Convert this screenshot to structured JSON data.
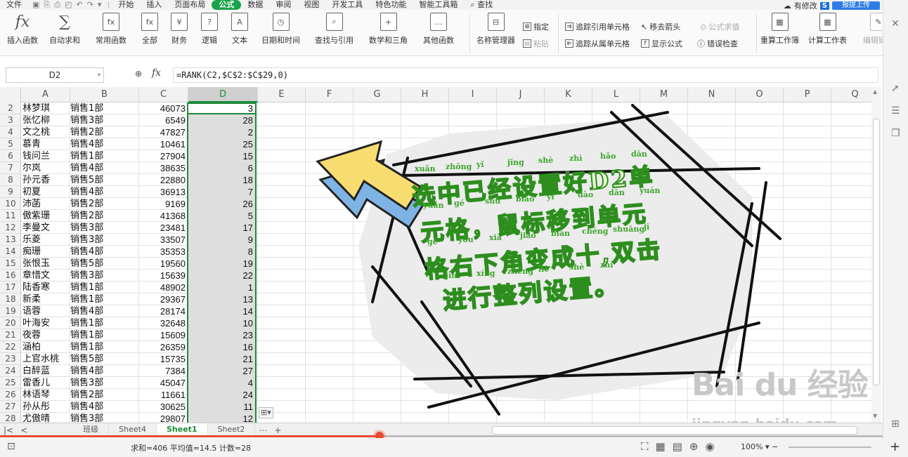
{
  "menu": {
    "file": "文件",
    "items": [
      "开始",
      "插入",
      "页面布局",
      "公式",
      "数据",
      "审阅",
      "视图",
      "开发工具",
      "特色功能",
      "智能工具箱"
    ],
    "active": "公式",
    "search": "查找",
    "modified": "有修改",
    "upload": "报提上传",
    "account_badge": "S"
  },
  "ribbon": {
    "insert_fn": "插入函数",
    "autosum": "自动求和",
    "common": "常用函数",
    "all": "全部",
    "finance": "财务",
    "logic": "逻辑",
    "text": "文本",
    "datetime": "日期和时间",
    "lookup": "查找与引用",
    "math": "数学和三角",
    "other": "其他函数",
    "name_mgr": "名称管理器",
    "define": "指定",
    "paste": "粘贴",
    "trace_prec": "追踪引用单元格",
    "trace_dep": "追踪从属单元格",
    "remove_arrows": "移去箭头",
    "show_formula": "显示公式",
    "eval": "公式求值",
    "error_check": "错误检查",
    "recalc_book": "重算工作簿",
    "calc_sheet": "计算工作表",
    "edit_links": "编辑链接"
  },
  "formula_bar": {
    "name_box": "D2",
    "fx": "fx",
    "formula": "=RANK(C2,$C$2:$C$29,0)"
  },
  "columns": [
    "A",
    "B",
    "C",
    "D",
    "E",
    "F",
    "G",
    "H",
    "I",
    "J",
    "K",
    "L",
    "M",
    "N",
    "O",
    "P",
    "Q"
  ],
  "selected_column": "D",
  "rows": [
    {
      "n": "2",
      "a": "林梦琪",
      "b": "销售1部",
      "c": "46073",
      "d": "3"
    },
    {
      "n": "3",
      "a": "张忆柳",
      "b": "销售3部",
      "c": "6549",
      "d": "28"
    },
    {
      "n": "4",
      "a": "文之桃",
      "b": "销售2部",
      "c": "47827",
      "d": "2"
    },
    {
      "n": "5",
      "a": "慕青",
      "b": "销售4部",
      "c": "10461",
      "d": "25"
    },
    {
      "n": "6",
      "a": "钱问兰",
      "b": "销售1部",
      "c": "27904",
      "d": "15"
    },
    {
      "n": "7",
      "a": "尔岚",
      "b": "销售4部",
      "c": "38635",
      "d": "6"
    },
    {
      "n": "8",
      "a": "孙元香",
      "b": "销售5部",
      "c": "22880",
      "d": "18"
    },
    {
      "n": "9",
      "a": "初夏",
      "b": "销售4部",
      "c": "36913",
      "d": "7"
    },
    {
      "n": "10",
      "a": "沛菡",
      "b": "销售2部",
      "c": "9169",
      "d": "26"
    },
    {
      "n": "11",
      "a": "傲紫珊",
      "b": "销售2部",
      "c": "41368",
      "d": "5"
    },
    {
      "n": "12",
      "a": "李曼文",
      "b": "销售3部",
      "c": "23481",
      "d": "17"
    },
    {
      "n": "13",
      "a": "乐菱",
      "b": "销售3部",
      "c": "33507",
      "d": "9"
    },
    {
      "n": "14",
      "a": "痴珊",
      "b": "销售4部",
      "c": "35353",
      "d": "8"
    },
    {
      "n": "15",
      "a": "张恨玉",
      "b": "销售5部",
      "c": "19560",
      "d": "19"
    },
    {
      "n": "16",
      "a": "章惜文",
      "b": "销售3部",
      "c": "15639",
      "d": "22"
    },
    {
      "n": "17",
      "a": "陆香寒",
      "b": "销售1部",
      "c": "48902",
      "d": "1"
    },
    {
      "n": "18",
      "a": "新柔",
      "b": "销售1部",
      "c": "29367",
      "d": "13"
    },
    {
      "n": "19",
      "a": "语蓉",
      "b": "销售4部",
      "c": "28174",
      "d": "14"
    },
    {
      "n": "20",
      "a": "叶海安",
      "b": "销售1部",
      "c": "32648",
      "d": "10"
    },
    {
      "n": "21",
      "a": "夜蓉",
      "b": "销售1部",
      "c": "15609",
      "d": "23"
    },
    {
      "n": "22",
      "a": "涵柏",
      "b": "销售1部",
      "c": "26359",
      "d": "16"
    },
    {
      "n": "23",
      "a": "上官水桃",
      "b": "销售5部",
      "c": "15735",
      "d": "21"
    },
    {
      "n": "24",
      "a": "白醉蓝",
      "b": "销售4部",
      "c": "7384",
      "d": "27"
    },
    {
      "n": "25",
      "a": "雷香儿",
      "b": "销售3部",
      "c": "45047",
      "d": "4"
    },
    {
      "n": "26",
      "a": "林语琴",
      "b": "销售2部",
      "c": "11661",
      "d": "24"
    },
    {
      "n": "27",
      "a": "孙从彤",
      "b": "销售4部",
      "c": "30625",
      "d": "11"
    },
    {
      "n": "28",
      "a": "尤傲晴",
      "b": "销售3部",
      "c": "29807",
      "d": "12"
    }
  ],
  "sheets": [
    "班级",
    "Sheet4",
    "Sheet1",
    "Sheet2"
  ],
  "active_sheet": "Sheet1",
  "status": {
    "summary": "求和=406  平均值=14.5  计数=28",
    "zoom": "100%"
  },
  "video_progress": 0.43,
  "annotation": {
    "lines": [
      "选中已经设置好D2单",
      "元格，鼠标移到单元",
      "格右下角变成十,双击",
      "进行整列设置。"
    ],
    "pinyin": [
      [
        "xuǎn",
        "zhōng",
        "yǐ",
        "jīng",
        "shè",
        "zhì",
        "hǎo",
        "dān"
      ],
      [
        "yuán",
        "gé",
        "shǔ",
        "biāo",
        "yí",
        "dào",
        "dān",
        "yuán"
      ],
      [
        "gé",
        "yòu",
        "xià",
        "jiǎo",
        "biàn",
        "chéng",
        "shuāng",
        "jī"
      ],
      [
        "jìn",
        "xíng",
        "zhěng",
        "liè",
        "shè",
        "zhì"
      ]
    ]
  },
  "watermark": {
    "main": "Bai du 经验",
    "sub": "jingyan.baidu.com"
  },
  "colors": {
    "accent": "#1e8a3a",
    "progress": "#e84a2f",
    "arrow": "#f7dc6f"
  }
}
